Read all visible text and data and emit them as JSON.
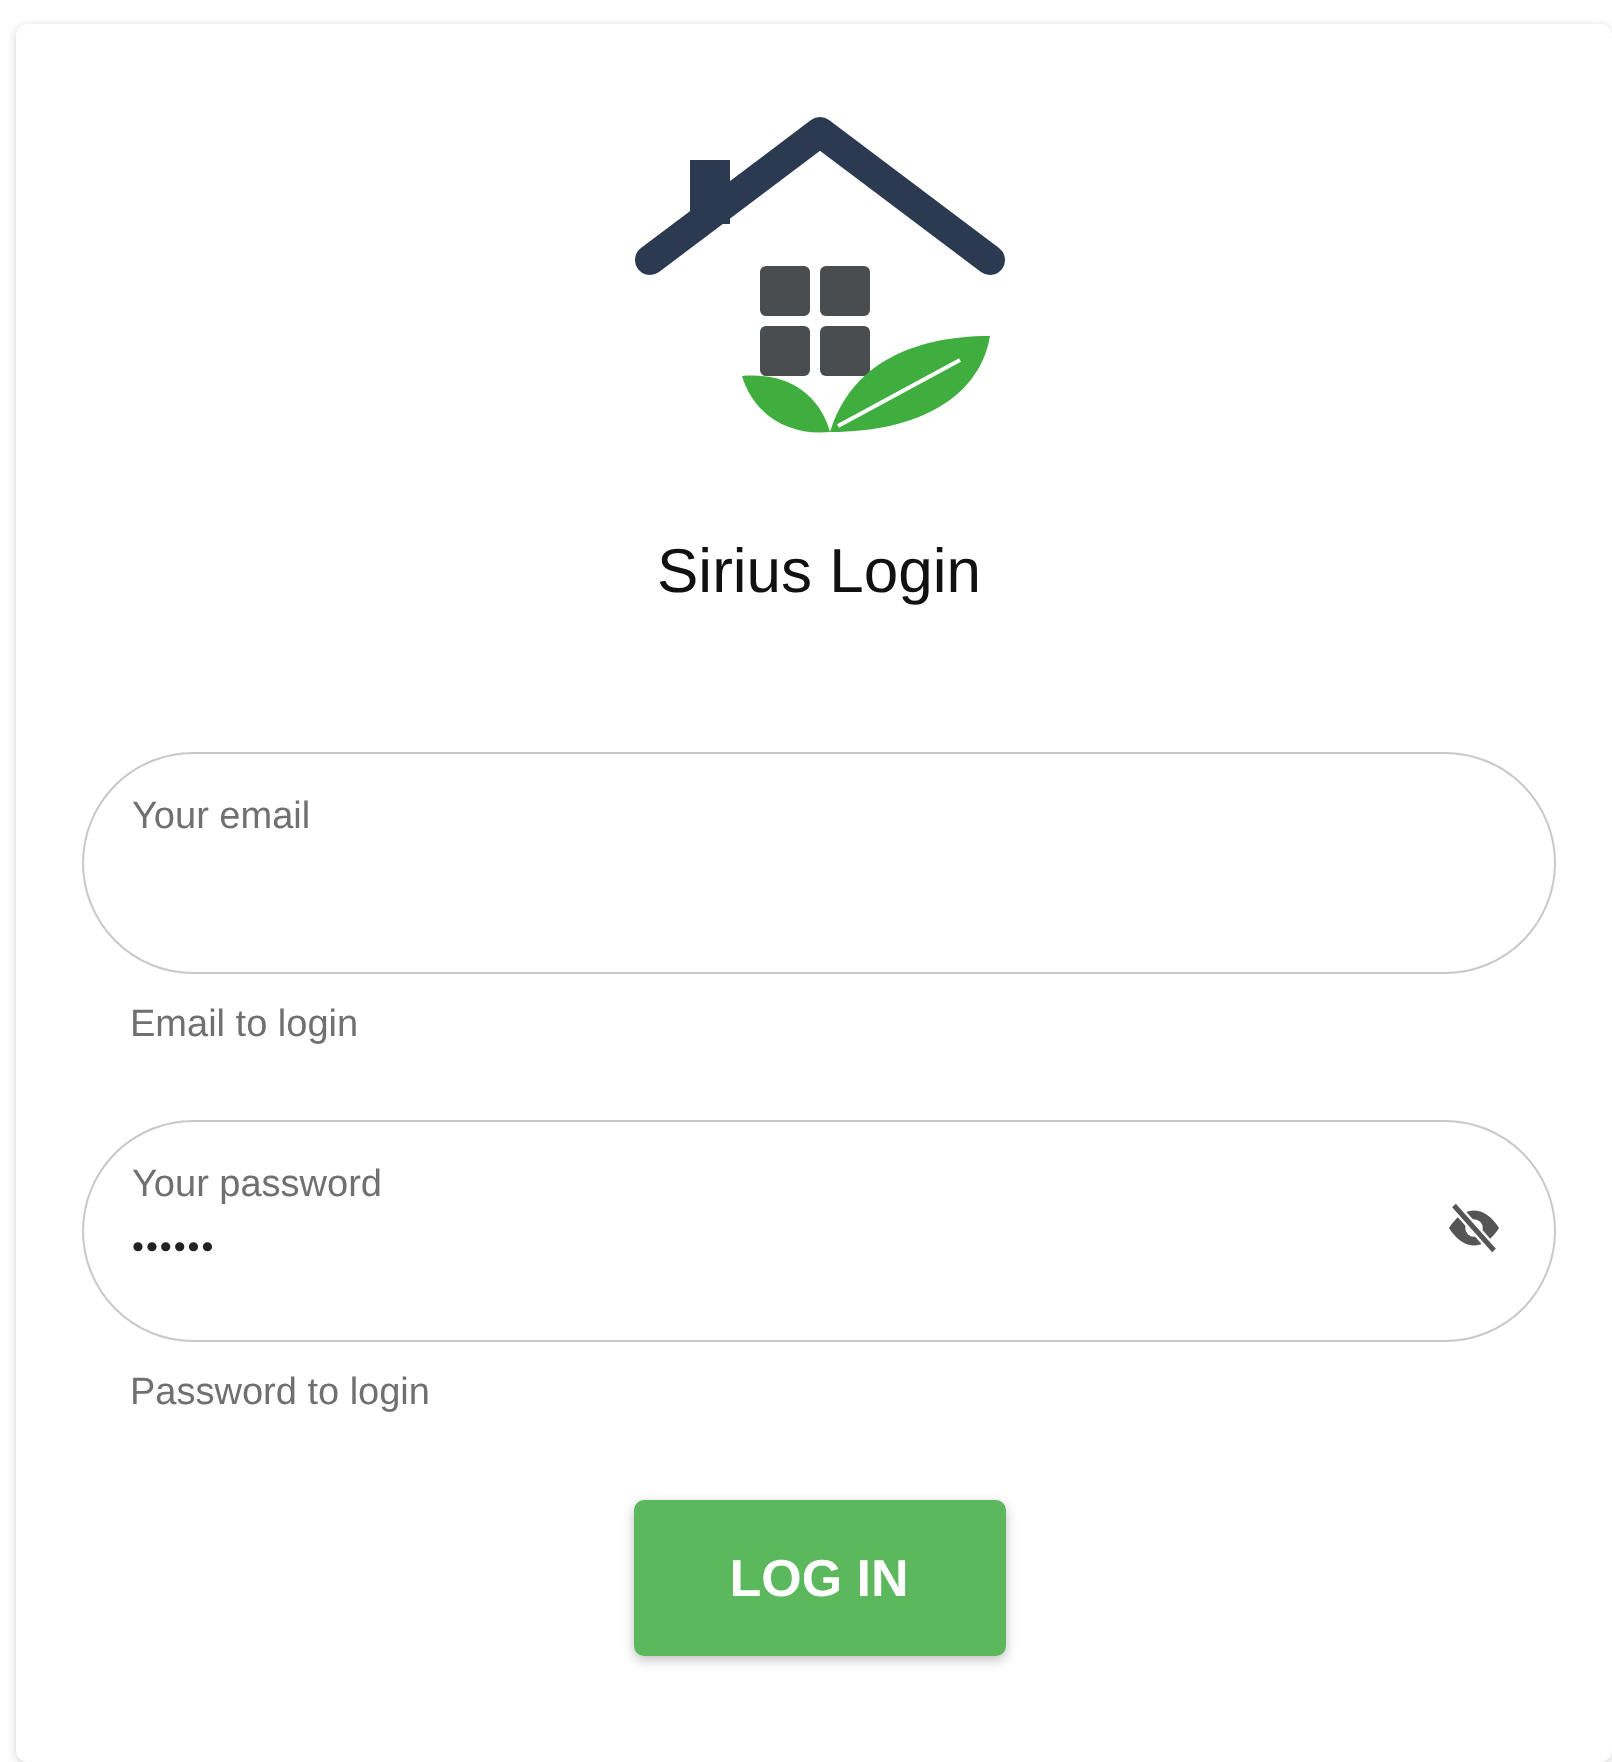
{
  "title": "Sirius Login",
  "fields": [
    {
      "kind": "email",
      "label": "Your email",
      "hint": "Email to login"
    },
    {
      "kind": "password",
      "label": "Your password",
      "value": "••••••",
      "hint": "Password to login",
      "revealed": false
    }
  ],
  "button": "LOG IN"
}
